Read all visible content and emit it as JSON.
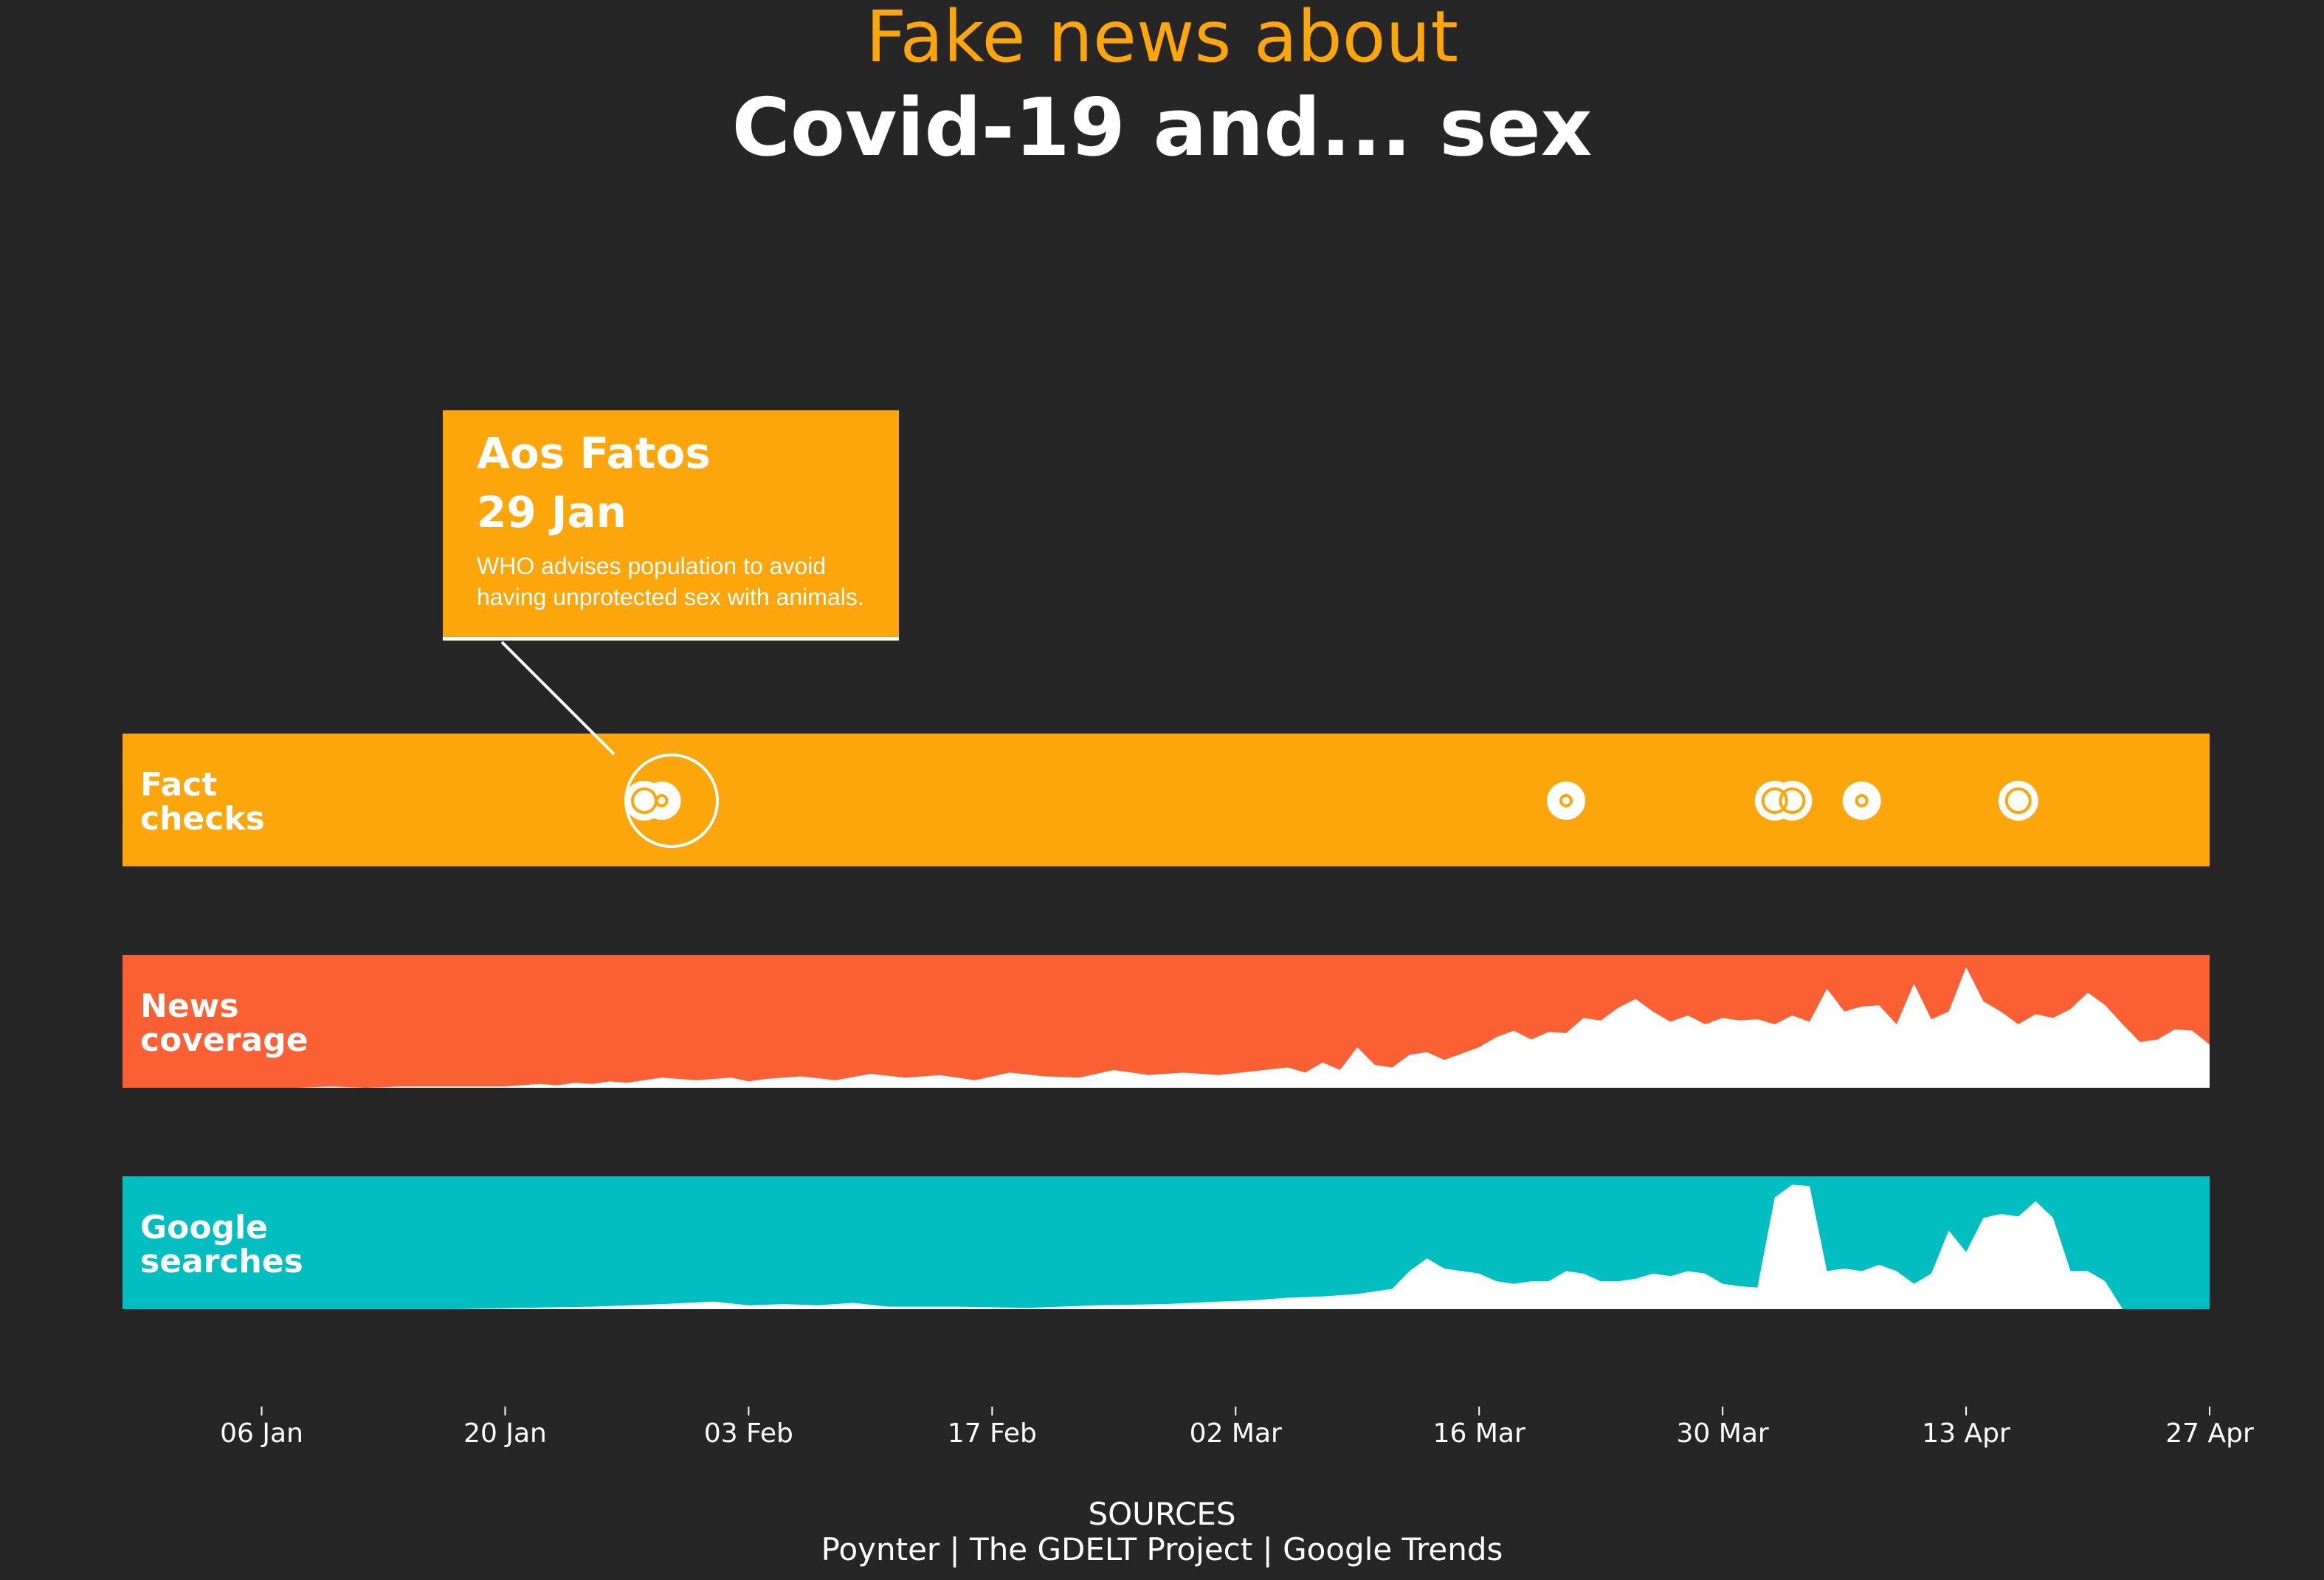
{
  "header": {
    "title_line1": "Fake news about",
    "title_line2": "Covid-19 and... sex"
  },
  "colors": {
    "background": "#262626",
    "fact_checks": "#fca60c",
    "news_coverage": "#fb6035",
    "google_searches": "#02bec1",
    "area_fill": "#ffffff"
  },
  "callout": {
    "source": "Aos Fatos",
    "date": "29 Jan",
    "text": "WHO advises population to avoid having unprotected sex with animals."
  },
  "sources": {
    "heading": "SOURCES",
    "list": "Poynter | The GDELT Project | Google Trends"
  },
  "chart_data": {
    "type": "area",
    "x_axis": {
      "ticks": [
        "06 Jan",
        "20 Jan",
        "03 Feb",
        "17 Feb",
        "02 Mar",
        "16 Mar",
        "30 Mar",
        "13 Apr",
        "27 Apr"
      ],
      "tick_dates": [
        "2020-01-06",
        "2020-01-20",
        "2020-02-03",
        "2020-02-17",
        "2020-03-02",
        "2020-03-16",
        "2020-03-30",
        "2020-04-13",
        "2020-04-27"
      ],
      "range": [
        "2019-12-29",
        "2020-04-27"
      ]
    },
    "tracks": [
      {
        "name": "Fact checks",
        "label_lines": [
          "Fact",
          "checks"
        ],
        "kind": "dots",
        "points": [
          {
            "date": "2020-01-28",
            "size": "medium",
            "highlight": true
          },
          {
            "date": "2020-01-29",
            "size": "small",
            "highlight": true
          },
          {
            "date": "2020-03-21",
            "size": "small"
          },
          {
            "date": "2020-04-02",
            "size": "medium"
          },
          {
            "date": "2020-04-03",
            "size": "medium"
          },
          {
            "date": "2020-04-07",
            "size": "small"
          },
          {
            "date": "2020-04-16",
            "size": "medium"
          }
        ]
      },
      {
        "name": "News coverage",
        "label_lines": [
          "News",
          "coverage"
        ],
        "kind": "area",
        "ylim": [
          0,
          100
        ],
        "points": [
          [
            "2020-01-08",
            0
          ],
          [
            "2020-01-10",
            1
          ],
          [
            "2020-01-12",
            0
          ],
          [
            "2020-01-14",
            1
          ],
          [
            "2020-01-16",
            1
          ],
          [
            "2020-01-18",
            1
          ],
          [
            "2020-01-20",
            1
          ],
          [
            "2020-01-22",
            3
          ],
          [
            "2020-01-23",
            2
          ],
          [
            "2020-01-24",
            4
          ],
          [
            "2020-01-25",
            3
          ],
          [
            "2020-01-26",
            5
          ],
          [
            "2020-01-27",
            4
          ],
          [
            "2020-01-28",
            6
          ],
          [
            "2020-01-29",
            8
          ],
          [
            "2020-01-31",
            6
          ],
          [
            "2020-02-02",
            8
          ],
          [
            "2020-02-03",
            5
          ],
          [
            "2020-02-04",
            7
          ],
          [
            "2020-02-06",
            9
          ],
          [
            "2020-02-08",
            6
          ],
          [
            "2020-02-10",
            11
          ],
          [
            "2020-02-12",
            8
          ],
          [
            "2020-02-14",
            10
          ],
          [
            "2020-02-16",
            6
          ],
          [
            "2020-02-18",
            12
          ],
          [
            "2020-02-20",
            9
          ],
          [
            "2020-02-22",
            8
          ],
          [
            "2020-02-24",
            14
          ],
          [
            "2020-02-26",
            10
          ],
          [
            "2020-02-28",
            12
          ],
          [
            "2020-03-01",
            10
          ],
          [
            "2020-03-03",
            13
          ],
          [
            "2020-03-05",
            16
          ],
          [
            "2020-03-06",
            12
          ],
          [
            "2020-03-07",
            20
          ],
          [
            "2020-03-08",
            14
          ],
          [
            "2020-03-09",
            32
          ],
          [
            "2020-03-10",
            18
          ],
          [
            "2020-03-11",
            16
          ],
          [
            "2020-03-12",
            26
          ],
          [
            "2020-03-13",
            28
          ],
          [
            "2020-03-14",
            22
          ],
          [
            "2020-03-16",
            32
          ],
          [
            "2020-03-17",
            40
          ],
          [
            "2020-03-18",
            45
          ],
          [
            "2020-03-19",
            38
          ],
          [
            "2020-03-20",
            44
          ],
          [
            "2020-03-21",
            43
          ],
          [
            "2020-03-22",
            55
          ],
          [
            "2020-03-23",
            53
          ],
          [
            "2020-03-24",
            63
          ],
          [
            "2020-03-25",
            70
          ],
          [
            "2020-03-26",
            60
          ],
          [
            "2020-03-27",
            52
          ],
          [
            "2020-03-28",
            57
          ],
          [
            "2020-03-29",
            50
          ],
          [
            "2020-03-30",
            55
          ],
          [
            "2020-03-31",
            53
          ],
          [
            "2020-04-01",
            54
          ],
          [
            "2020-04-02",
            50
          ],
          [
            "2020-04-03",
            57
          ],
          [
            "2020-04-04",
            52
          ],
          [
            "2020-04-05",
            78
          ],
          [
            "2020-04-06",
            60
          ],
          [
            "2020-04-07",
            64
          ],
          [
            "2020-04-08",
            65
          ],
          [
            "2020-04-09",
            50
          ],
          [
            "2020-04-10",
            82
          ],
          [
            "2020-04-11",
            54
          ],
          [
            "2020-04-12",
            60
          ],
          [
            "2020-04-13",
            95
          ],
          [
            "2020-04-14",
            68
          ],
          [
            "2020-04-15",
            60
          ],
          [
            "2020-04-16",
            50
          ],
          [
            "2020-04-17",
            58
          ],
          [
            "2020-04-18",
            55
          ],
          [
            "2020-04-19",
            62
          ],
          [
            "2020-04-20",
            75
          ],
          [
            "2020-04-21",
            65
          ],
          [
            "2020-04-22",
            50
          ],
          [
            "2020-04-23",
            36
          ],
          [
            "2020-04-24",
            38
          ],
          [
            "2020-04-25",
            46
          ],
          [
            "2020-04-26",
            45
          ],
          [
            "2020-04-27",
            34
          ]
        ]
      },
      {
        "name": "Google searches",
        "label_lines": [
          "Google",
          "searches"
        ],
        "kind": "area",
        "ylim": [
          0,
          100
        ],
        "points": [
          [
            "2020-01-17",
            0
          ],
          [
            "2020-01-21",
            1
          ],
          [
            "2020-01-25",
            2
          ],
          [
            "2020-01-29",
            4
          ],
          [
            "2020-02-01",
            6
          ],
          [
            "2020-02-03",
            3
          ],
          [
            "2020-02-05",
            4
          ],
          [
            "2020-02-07",
            3
          ],
          [
            "2020-02-09",
            5
          ],
          [
            "2020-02-11",
            2
          ],
          [
            "2020-02-15",
            2
          ],
          [
            "2020-02-19",
            1
          ],
          [
            "2020-02-23",
            3
          ],
          [
            "2020-02-27",
            4
          ],
          [
            "2020-03-01",
            6
          ],
          [
            "2020-03-03",
            7
          ],
          [
            "2020-03-05",
            9
          ],
          [
            "2020-03-07",
            10
          ],
          [
            "2020-03-09",
            12
          ],
          [
            "2020-03-11",
            16
          ],
          [
            "2020-03-12",
            30
          ],
          [
            "2020-03-13",
            40
          ],
          [
            "2020-03-14",
            32
          ],
          [
            "2020-03-15",
            30
          ],
          [
            "2020-03-16",
            28
          ],
          [
            "2020-03-17",
            22
          ],
          [
            "2020-03-18",
            20
          ],
          [
            "2020-03-19",
            22
          ],
          [
            "2020-03-20",
            22
          ],
          [
            "2020-03-21",
            30
          ],
          [
            "2020-03-22",
            28
          ],
          [
            "2020-03-23",
            22
          ],
          [
            "2020-03-24",
            22
          ],
          [
            "2020-03-25",
            24
          ],
          [
            "2020-03-26",
            28
          ],
          [
            "2020-03-27",
            26
          ],
          [
            "2020-03-28",
            30
          ],
          [
            "2020-03-29",
            28
          ],
          [
            "2020-03-30",
            20
          ],
          [
            "2020-03-31",
            18
          ],
          [
            "2020-04-01",
            17
          ],
          [
            "2020-04-02",
            88
          ],
          [
            "2020-04-03",
            98
          ],
          [
            "2020-04-04",
            97
          ],
          [
            "2020-04-05",
            30
          ],
          [
            "2020-04-06",
            32
          ],
          [
            "2020-04-07",
            30
          ],
          [
            "2020-04-08",
            35
          ],
          [
            "2020-04-09",
            30
          ],
          [
            "2020-04-10",
            20
          ],
          [
            "2020-04-11",
            28
          ],
          [
            "2020-04-12",
            62
          ],
          [
            "2020-04-13",
            45
          ],
          [
            "2020-04-14",
            72
          ],
          [
            "2020-04-15",
            75
          ],
          [
            "2020-04-16",
            73
          ],
          [
            "2020-04-17",
            85
          ],
          [
            "2020-04-18",
            72
          ],
          [
            "2020-04-19",
            30
          ],
          [
            "2020-04-20",
            30
          ],
          [
            "2020-04-21",
            22
          ],
          [
            "2020-04-22",
            0
          ]
        ]
      }
    ]
  }
}
